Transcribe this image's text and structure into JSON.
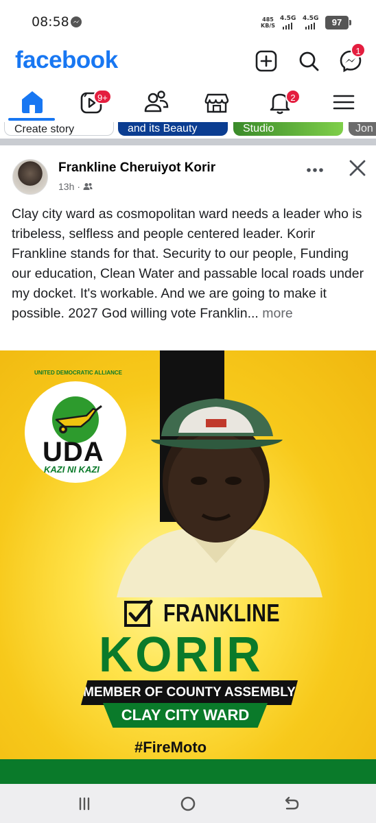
{
  "status": {
    "time": "08:58",
    "net_speed_value": "485",
    "net_speed_unit": "KB/S",
    "signal1_label": "4.5G",
    "signal2_label": "4.5G",
    "battery": "97"
  },
  "header": {
    "logo": "facebook",
    "messenger_badge": "1"
  },
  "nav": {
    "video_badge": "9+",
    "notifications_badge": "2"
  },
  "stories": [
    {
      "label": "Create story"
    },
    {
      "label": "and its Beauty"
    },
    {
      "label": "Studio"
    },
    {
      "label": "Jon"
    }
  ],
  "post": {
    "author": "Frankline Cheruiyot Korir",
    "time": "13h",
    "body": "Clay city ward as cosmopolitan ward needs a leader who is tribeless, selfless and people centered leader. Korir Frankline stands for that. Security to our people, Funding our education, Clean Water and passable local roads under my docket. It's workable. And we are going to make it possible. 2027 God willing vote Franklin...",
    "more": "more"
  },
  "poster": {
    "party": "UDA",
    "party_arc": "UNITED DEMOCRATIC ALLIANCE",
    "motto": "KAZI NI KAZI",
    "first_name": "FRANKLINE",
    "last_name": "KORIR",
    "role": "MEMBER OF COUNTY ASSEMBLY",
    "ward": "CLAY CITY WARD",
    "hashtag": "#FireMoto"
  },
  "colors": {
    "brand": "#1877f2",
    "badge": "#e41e3f",
    "uda_green": "#0a7a2a",
    "poster_yellow": "#f7c91b"
  }
}
